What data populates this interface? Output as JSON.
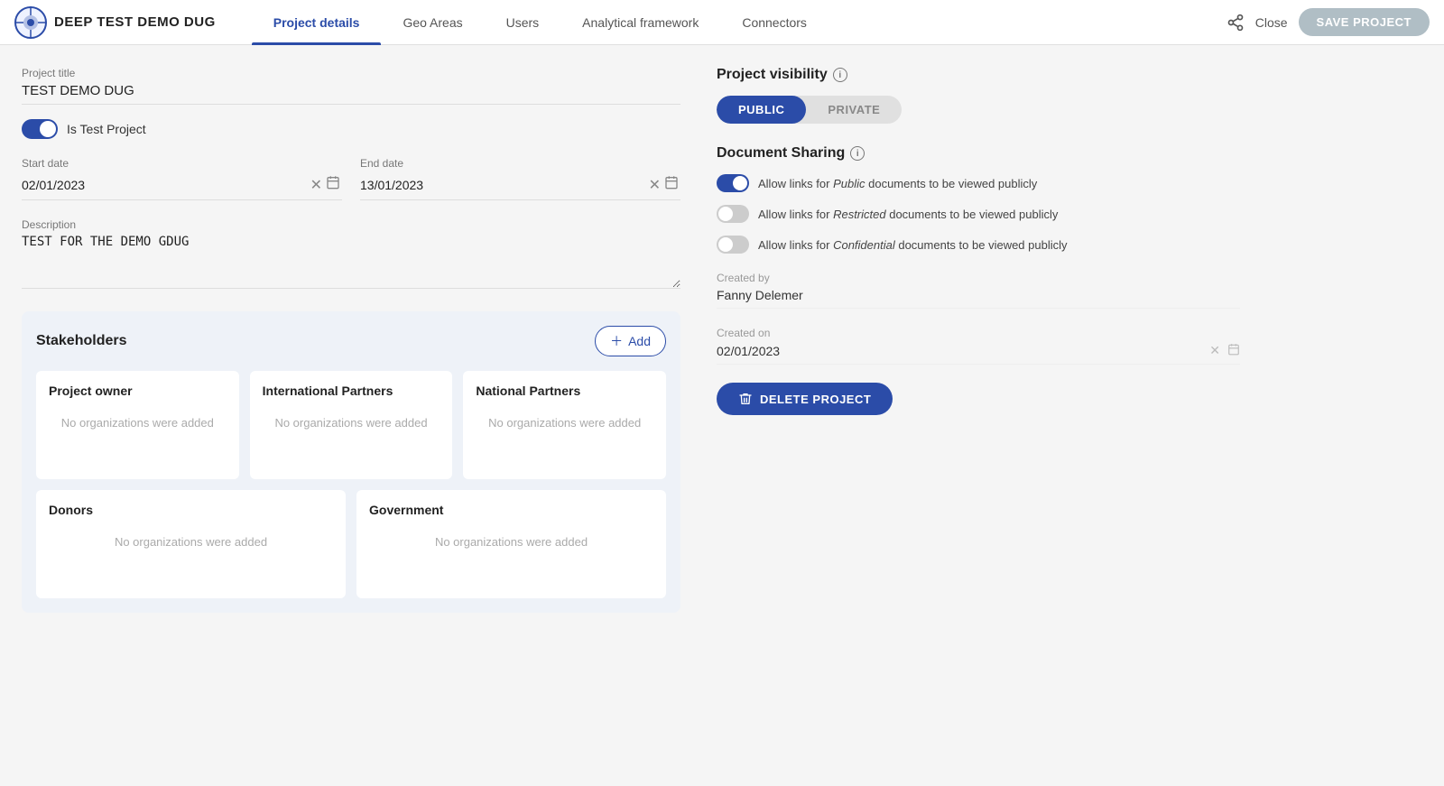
{
  "header": {
    "logo_text": "DEEP TEST DEMO DUG",
    "nav_tabs": [
      {
        "id": "project-details",
        "label": "Project details",
        "active": true
      },
      {
        "id": "geo-areas",
        "label": "Geo Areas",
        "active": false
      },
      {
        "id": "users",
        "label": "Users",
        "active": false
      },
      {
        "id": "analytical-framework",
        "label": "Analytical framework",
        "active": false
      },
      {
        "id": "connectors",
        "label": "Connectors",
        "active": false
      }
    ],
    "close_label": "Close",
    "save_label": "SAVE PROJECT"
  },
  "left": {
    "project_title_label": "Project title",
    "project_title_value": "TEST DEMO DUG",
    "is_test_project_label": "Is Test Project",
    "start_date_label": "Start date",
    "start_date_value": "02/01/2023",
    "end_date_label": "End date",
    "end_date_value": "13/01/2023",
    "description_label": "Description",
    "description_value": "TEST FOR THE DEMO GDUG",
    "stakeholders_title": "Stakeholders",
    "add_button_label": "+ Add",
    "stakeholder_cards": [
      {
        "title": "Project owner",
        "empty_text": "No organizations were added"
      },
      {
        "title": "International Partners",
        "empty_text": "No organizations were added"
      },
      {
        "title": "National Partners",
        "empty_text": "No organizations were added"
      },
      {
        "title": "Donors",
        "empty_text": "No organizations were added"
      },
      {
        "title": "Government",
        "empty_text": "No organizations were added"
      }
    ]
  },
  "right": {
    "visibility_label": "Project visibility",
    "visibility_options": [
      {
        "id": "public",
        "label": "PUBLIC",
        "active": true
      },
      {
        "id": "private",
        "label": "PRIVATE",
        "active": false
      }
    ],
    "doc_sharing_label": "Document Sharing",
    "sharing_rows": [
      {
        "id": "public-docs",
        "on": true,
        "text_before": "Allow links for ",
        "text_italic": "Public",
        "text_after": " documents to be viewed publicly"
      },
      {
        "id": "restricted-docs",
        "on": false,
        "text_before": "Allow links for ",
        "text_italic": "Restricted",
        "text_after": " documents to be viewed publicly"
      },
      {
        "id": "confidential-docs",
        "on": false,
        "text_before": "Allow links for ",
        "text_italic": "Confidential",
        "text_after": " documents to be viewed publicly"
      }
    ],
    "created_by_label": "Created by",
    "created_by_value": "Fanny Delemer",
    "created_on_label": "Created on",
    "created_on_value": "02/01/2023",
    "delete_button_label": "DELETE PROJECT"
  }
}
